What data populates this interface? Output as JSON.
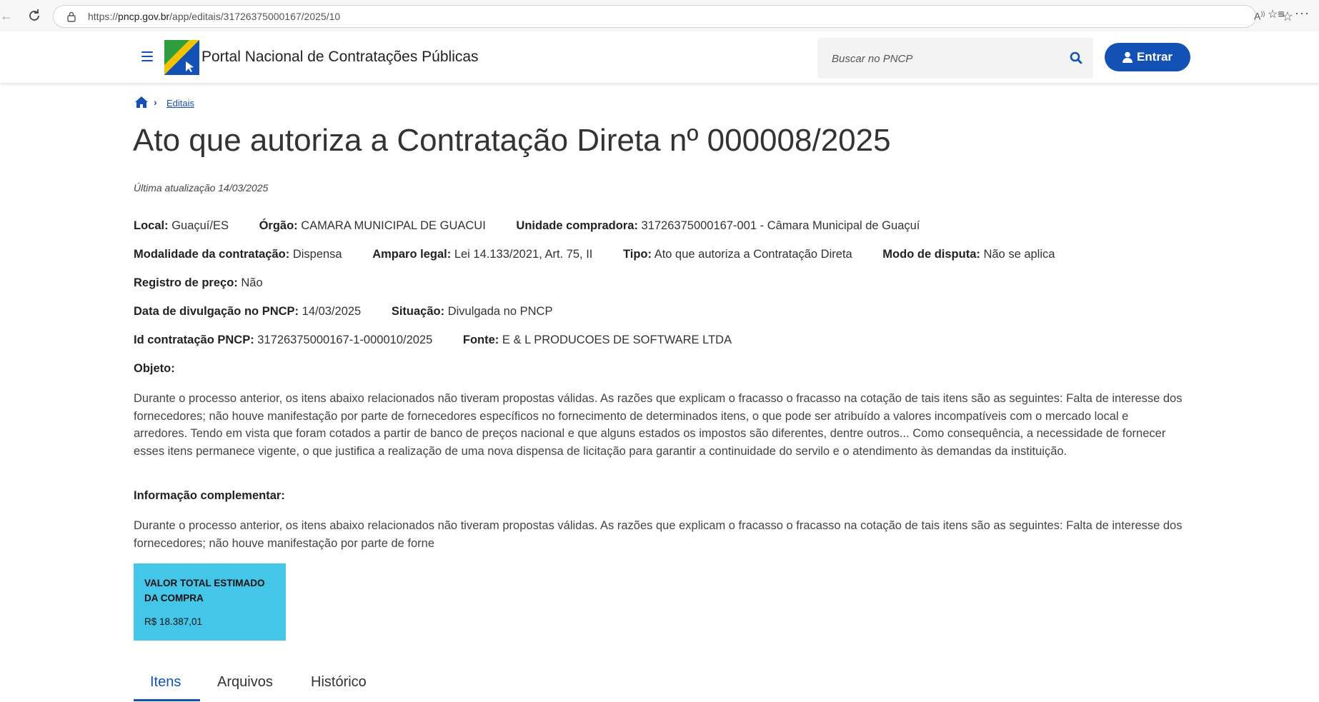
{
  "browser": {
    "url_prefix": "https://",
    "url_host": "pncp.gov.br",
    "url_path": "/app/editais/31726375000167/2025/10"
  },
  "header": {
    "site_title": "Portal Nacional de Contratações Públicas",
    "search_placeholder": "Buscar no PNCP",
    "login_label": "Entrar",
    "accent_color": "#1351b4"
  },
  "breadcrumb": {
    "items": [
      "Editais"
    ]
  },
  "page": {
    "title": "Ato que autoriza a Contratação Direta nº 000008/2025",
    "last_updated": "Última atualização 14/03/2025"
  },
  "details": {
    "local": {
      "label": "Local:",
      "value": "Guaçuí/ES"
    },
    "orgao": {
      "label": "Órgão:",
      "value": "CAMARA MUNICIPAL DE GUACUI"
    },
    "unidade": {
      "label": "Unidade compradora:",
      "value": "31726375000167-001 - Câmara Municipal de Guaçuí"
    },
    "modalidade": {
      "label": "Modalidade da contratação:",
      "value": "Dispensa"
    },
    "amparo": {
      "label": "Amparo legal:",
      "value": "Lei 14.133/2021, Art. 75, II"
    },
    "tipo": {
      "label": "Tipo:",
      "value": "Ato que autoriza a Contratação Direta"
    },
    "modo_disputa": {
      "label": "Modo de disputa:",
      "value": "Não se aplica"
    },
    "registro_preco": {
      "label": "Registro de preço:",
      "value": "Não"
    },
    "data_divulgacao": {
      "label": "Data de divulgação no PNCP:",
      "value": "14/03/2025"
    },
    "situacao": {
      "label": "Situação:",
      "value": "Divulgada no PNCP"
    },
    "id_contratacao": {
      "label": "Id contratação PNCP:",
      "value": "31726375000167-1-000010/2025"
    },
    "fonte": {
      "label": "Fonte:",
      "value": "E & L PRODUCOES DE SOFTWARE LTDA"
    }
  },
  "objeto": {
    "label": "Objeto:",
    "text": "Durante o processo anterior, os itens abaixo relacionados não tiveram propostas válidas. As razões que explicam o fracasso o fracasso na cotação de tais itens são as seguintes: Falta de interesse dos fornecedores; não houve manifestação por parte de fornecedores específicos no fornecimento de determinados itens, o que pode ser atribuído a valores incompatíveis com o mercado local e arredores. Tendo em vista que foram cotados a partir de banco de preços nacional e que alguns estados os impostos são diferentes, dentre outros... Como consequência, a necessidade de fornecer esses itens permanece vigente, o que justifica a realização de uma nova dispensa de licitação para garantir a continuidade do servilo e o atendimento às demandas da instituição."
  },
  "info_complementar": {
    "label": "Informação complementar:",
    "text": "Durante o processo anterior, os itens abaixo relacionados não tiveram propostas válidas. As razões que explicam o fracasso o fracasso na cotação de tais itens são as seguintes: Falta de interesse dos fornecedores; não houve manifestação por parte de forne"
  },
  "value_card": {
    "title": "VALOR TOTAL ESTIMADO DA COMPRA",
    "amount": "R$ 18.387,01",
    "color": "#43c6e8"
  },
  "tabs": [
    {
      "label": "Itens",
      "active": true
    },
    {
      "label": "Arquivos",
      "active": false
    },
    {
      "label": "Histórico",
      "active": false
    }
  ]
}
